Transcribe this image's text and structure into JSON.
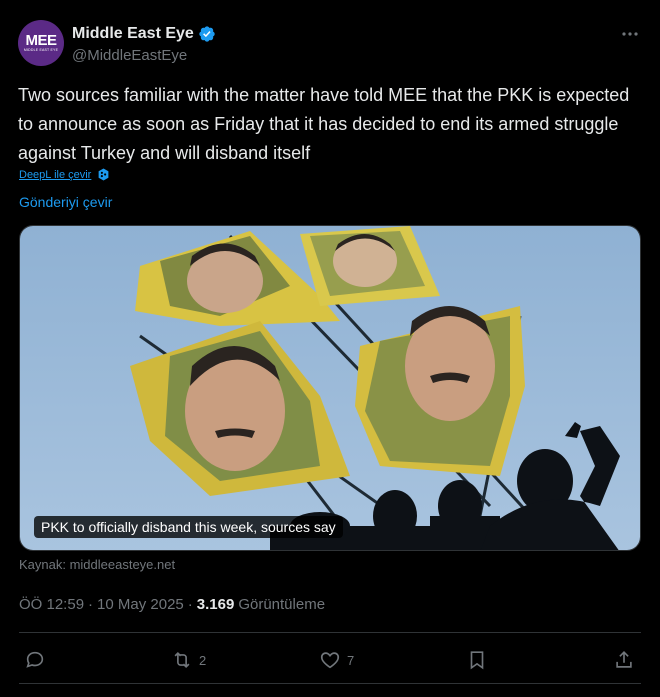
{
  "account": {
    "display_name": "Middle East Eye",
    "handle": "@MiddleEastEye",
    "avatar_text": "MEE",
    "avatar_subtext": "MIDDLE EAST EYE",
    "verified_icon": "verified-badge-icon",
    "brand_color": "#5b2a86"
  },
  "tweet": {
    "text": "Two sources familiar with the matter have told MEE that the PKK is expected to announce as soon as Friday that it has decided to end its armed struggle against Turkey and will disband itself",
    "deepl_label": "DeepL ile çevir",
    "translate_label": "Gönderiyi çevir",
    "card_caption": "PKK to officially disband this week, sources say",
    "source_label": "Kaynak: middleeasteye.net",
    "time": "ÖÖ 12:59",
    "separator": "·",
    "date": "10 May 2025",
    "views_count": "3.169",
    "views_label": "Görüntüleme"
  },
  "actions": {
    "reply_count": "",
    "retweet_count": "2",
    "like_count": "7"
  },
  "colors": {
    "background": "#000000",
    "text": "#e7e9ea",
    "muted": "#71767b",
    "link": "#1d9bf0",
    "divider": "#2f3336"
  }
}
